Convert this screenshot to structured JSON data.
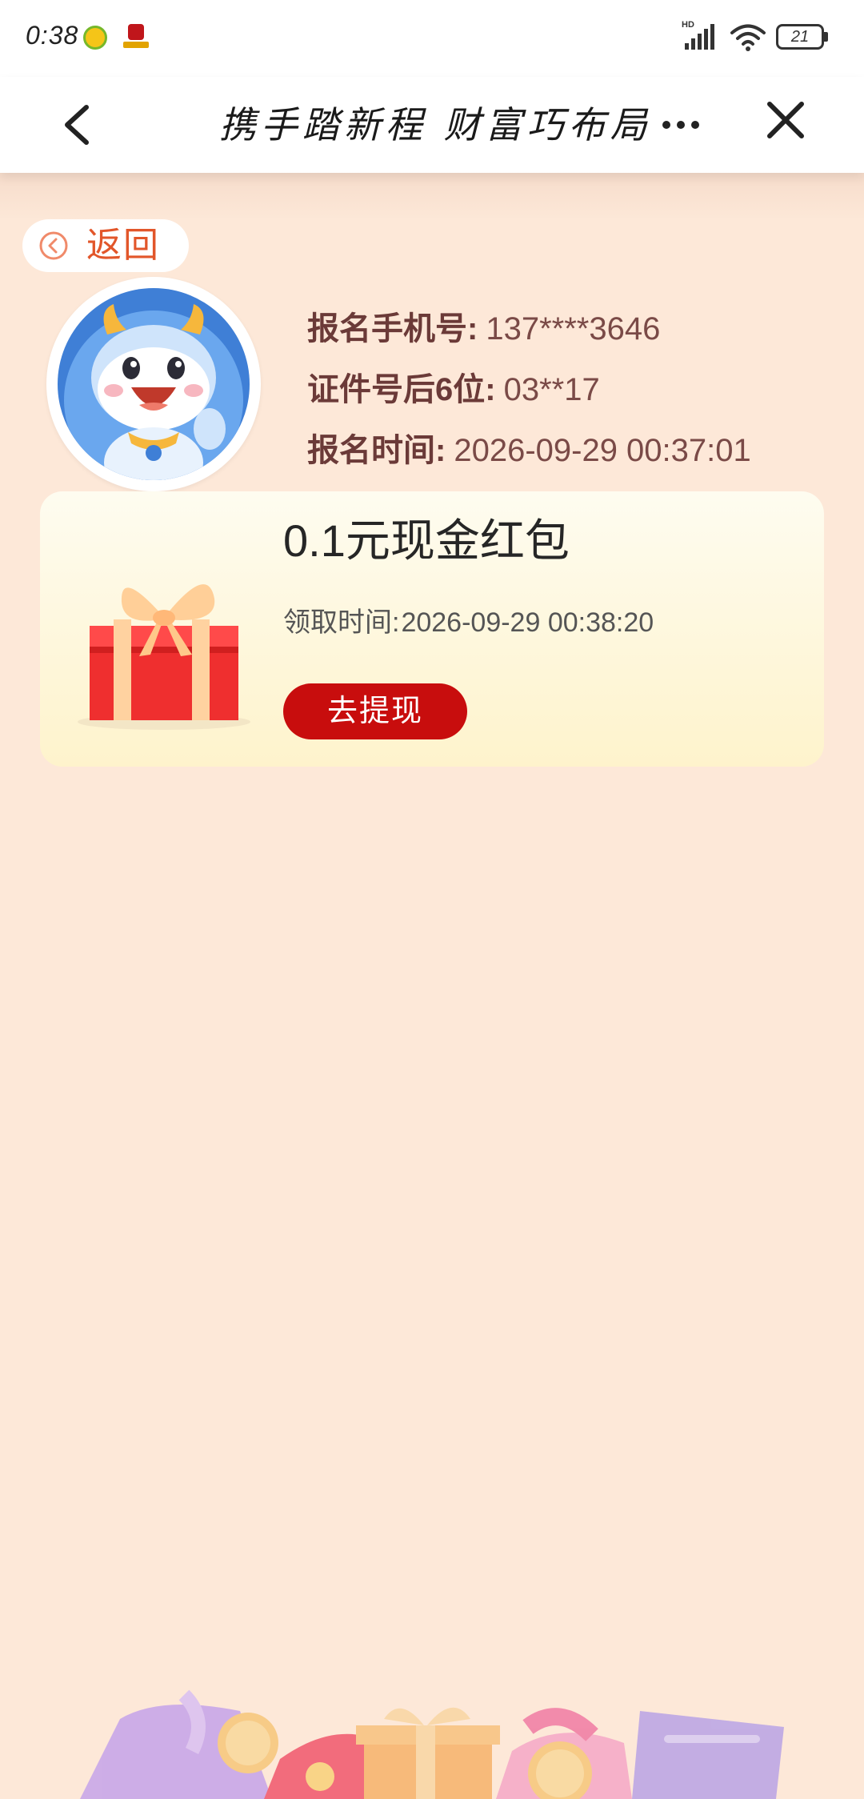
{
  "status_bar": {
    "time": "0:38",
    "network": "HD",
    "battery_level": "21"
  },
  "title_bar": {
    "title": "携手踏新程 财富巧布局"
  },
  "return_button": {
    "label": "返回"
  },
  "registration": {
    "phone_label": "报名手机号:",
    "phone_value": "137****3646",
    "id_label": "证件号后6位:",
    "id_value": "03**17",
    "time_label": "报名时间:",
    "time_value": "2026-09-29 00:37:01"
  },
  "reward": {
    "title": "0.1元现金红包",
    "claim_time_label": "领取时间:",
    "claim_time_value": "2026-09-29 00:38:20",
    "withdraw_label": "去提现"
  },
  "colors": {
    "background": "#fde8d8",
    "accent_red": "#c80d0d",
    "return_text": "#e2562a",
    "label_brown": "#6b3a38",
    "card_top": "#fefcf0",
    "card_bottom": "#fef3cc"
  },
  "icons": {
    "back": "chevron-left-icon",
    "more": "more-dots-icon",
    "close": "close-icon",
    "return": "circle-chevron-left-icon",
    "gift": "gift-box-icon",
    "avatar": "dragon-mascot-avatar"
  }
}
